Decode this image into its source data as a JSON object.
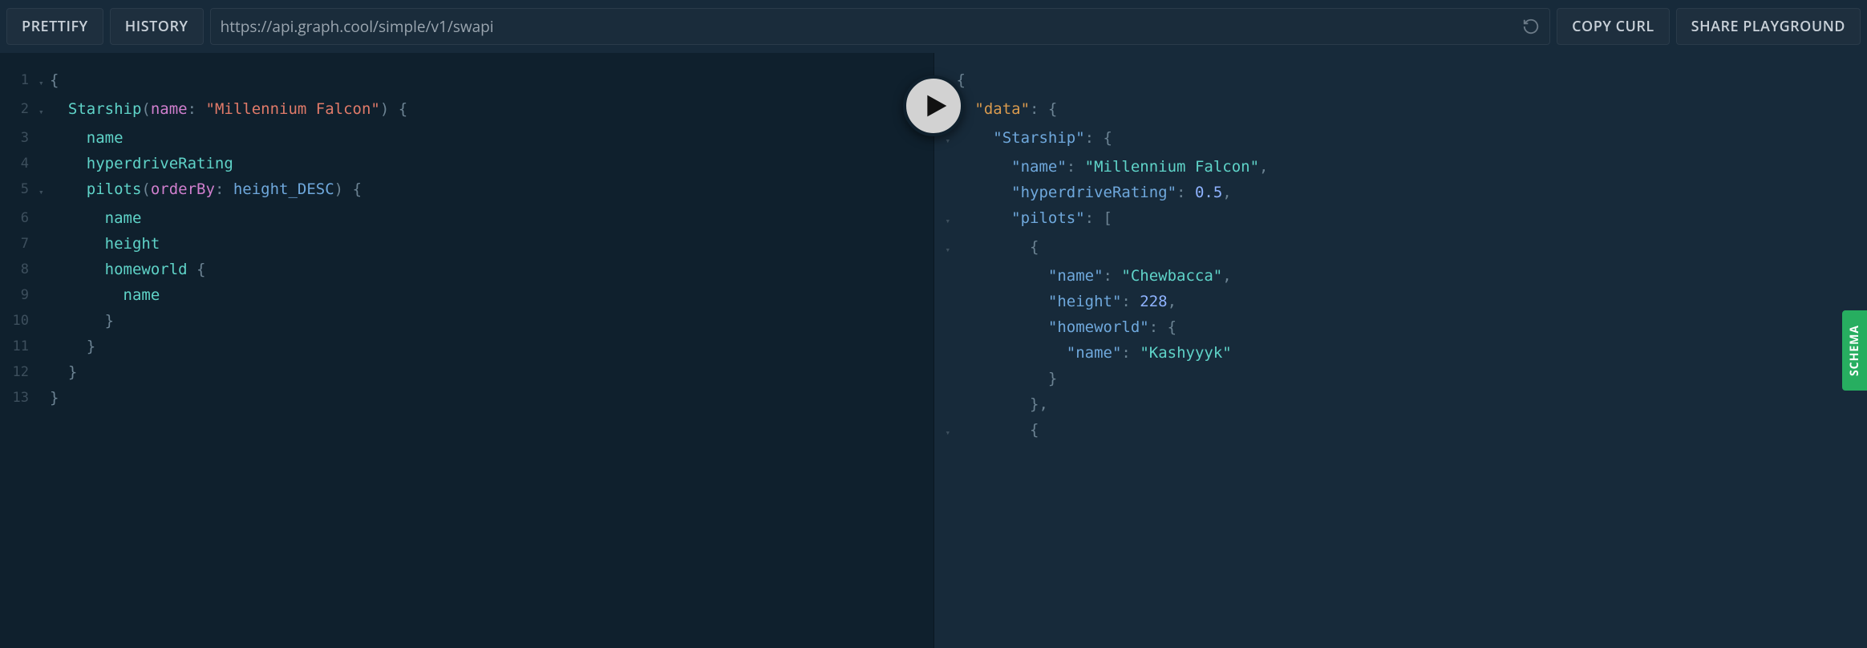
{
  "toolbar": {
    "prettify": "PRETTIFY",
    "history": "HISTORY",
    "copy_curl": "COPY CURL",
    "share_playground": "SHARE PLAYGROUND",
    "url": "https://api.graph.cool/simple/v1/swapi"
  },
  "schema_tab": "SCHEMA",
  "query": {
    "lines": [
      {
        "n": "1",
        "fold": "▾",
        "tokens": [
          [
            "brace",
            "{"
          ]
        ]
      },
      {
        "n": "2",
        "fold": "▾",
        "tokens": [
          [
            "plain",
            "  "
          ],
          [
            "field",
            "Starship"
          ],
          [
            "punc",
            "("
          ],
          [
            "arg",
            "name"
          ],
          [
            "colon",
            ": "
          ],
          [
            "str",
            "\"Millennium Falcon\""
          ],
          [
            "punc",
            ")"
          ],
          [
            "plain",
            " "
          ],
          [
            "brace",
            "{"
          ]
        ]
      },
      {
        "n": "3",
        "fold": "",
        "tokens": [
          [
            "plain",
            "    "
          ],
          [
            "field",
            "name"
          ]
        ]
      },
      {
        "n": "4",
        "fold": "",
        "tokens": [
          [
            "plain",
            "    "
          ],
          [
            "field",
            "hyperdriveRating"
          ]
        ]
      },
      {
        "n": "5",
        "fold": "▾",
        "tokens": [
          [
            "plain",
            "    "
          ],
          [
            "field",
            "pilots"
          ],
          [
            "punc",
            "("
          ],
          [
            "arg",
            "orderBy"
          ],
          [
            "colon",
            ": "
          ],
          [
            "enum",
            "height_DESC"
          ],
          [
            "punc",
            ")"
          ],
          [
            "plain",
            " "
          ],
          [
            "brace",
            "{"
          ]
        ]
      },
      {
        "n": "6",
        "fold": "",
        "tokens": [
          [
            "plain",
            "      "
          ],
          [
            "field",
            "name"
          ]
        ]
      },
      {
        "n": "7",
        "fold": "",
        "tokens": [
          [
            "plain",
            "      "
          ],
          [
            "field",
            "height"
          ]
        ]
      },
      {
        "n": "8",
        "fold": "",
        "tokens": [
          [
            "plain",
            "      "
          ],
          [
            "field",
            "homeworld"
          ],
          [
            "plain",
            " "
          ],
          [
            "brace",
            "{"
          ]
        ]
      },
      {
        "n": "9",
        "fold": "",
        "tokens": [
          [
            "plain",
            "        "
          ],
          [
            "field",
            "name"
          ]
        ]
      },
      {
        "n": "10",
        "fold": "",
        "tokens": [
          [
            "plain",
            "      "
          ],
          [
            "brace",
            "}"
          ]
        ]
      },
      {
        "n": "11",
        "fold": "",
        "tokens": [
          [
            "plain",
            "    "
          ],
          [
            "brace",
            "}"
          ]
        ]
      },
      {
        "n": "12",
        "fold": "",
        "tokens": [
          [
            "plain",
            "  "
          ],
          [
            "brace",
            "}"
          ]
        ]
      },
      {
        "n": "13",
        "fold": "",
        "tokens": [
          [
            "brace",
            "}"
          ]
        ]
      }
    ]
  },
  "result": {
    "lines": [
      {
        "fold": "▾",
        "tokens": [
          [
            "rpunc",
            "{"
          ]
        ]
      },
      {
        "fold": "▾",
        "tokens": [
          [
            "plain",
            "  "
          ],
          [
            "rdata",
            "\"data\""
          ],
          [
            "rpunc",
            ": "
          ],
          [
            "rpunc",
            "{"
          ]
        ]
      },
      {
        "fold": "▾",
        "tokens": [
          [
            "plain",
            "    "
          ],
          [
            "rkey",
            "\"Starship\""
          ],
          [
            "rpunc",
            ": "
          ],
          [
            "rpunc",
            "{"
          ]
        ]
      },
      {
        "fold": "",
        "tokens": [
          [
            "plain",
            "      "
          ],
          [
            "rkey",
            "\"name\""
          ],
          [
            "rpunc",
            ": "
          ],
          [
            "rstr",
            "\"Millennium Falcon\""
          ],
          [
            "rpunc",
            ","
          ]
        ]
      },
      {
        "fold": "",
        "tokens": [
          [
            "plain",
            "      "
          ],
          [
            "rkey",
            "\"hyperdriveRating\""
          ],
          [
            "rpunc",
            ": "
          ],
          [
            "rnum",
            "0.5"
          ],
          [
            "rpunc",
            ","
          ]
        ]
      },
      {
        "fold": "▾",
        "tokens": [
          [
            "plain",
            "      "
          ],
          [
            "rkey",
            "\"pilots\""
          ],
          [
            "rpunc",
            ": "
          ],
          [
            "rpunc",
            "["
          ]
        ]
      },
      {
        "fold": "▾",
        "tokens": [
          [
            "plain",
            "        "
          ],
          [
            "rpunc",
            "{"
          ]
        ]
      },
      {
        "fold": "",
        "tokens": [
          [
            "plain",
            "          "
          ],
          [
            "rkey",
            "\"name\""
          ],
          [
            "rpunc",
            ": "
          ],
          [
            "rstr",
            "\"Chewbacca\""
          ],
          [
            "rpunc",
            ","
          ]
        ]
      },
      {
        "fold": "",
        "tokens": [
          [
            "plain",
            "          "
          ],
          [
            "rkey",
            "\"height\""
          ],
          [
            "rpunc",
            ": "
          ],
          [
            "rnum",
            "228"
          ],
          [
            "rpunc",
            ","
          ]
        ]
      },
      {
        "fold": "",
        "tokens": [
          [
            "plain",
            "          "
          ],
          [
            "rkey",
            "\"homeworld\""
          ],
          [
            "rpunc",
            ": "
          ],
          [
            "rpunc",
            "{"
          ]
        ]
      },
      {
        "fold": "",
        "tokens": [
          [
            "plain",
            "            "
          ],
          [
            "rkey",
            "\"name\""
          ],
          [
            "rpunc",
            ": "
          ],
          [
            "rstr",
            "\"Kashyyyk\""
          ]
        ]
      },
      {
        "fold": "",
        "tokens": [
          [
            "plain",
            "          "
          ],
          [
            "rpunc",
            "}"
          ]
        ]
      },
      {
        "fold": "",
        "tokens": [
          [
            "plain",
            "        "
          ],
          [
            "rpunc",
            "}"
          ],
          [
            "rpunc",
            ","
          ]
        ]
      },
      {
        "fold": "▾",
        "tokens": [
          [
            "plain",
            "        "
          ],
          [
            "rpunc",
            "{"
          ]
        ]
      }
    ]
  }
}
